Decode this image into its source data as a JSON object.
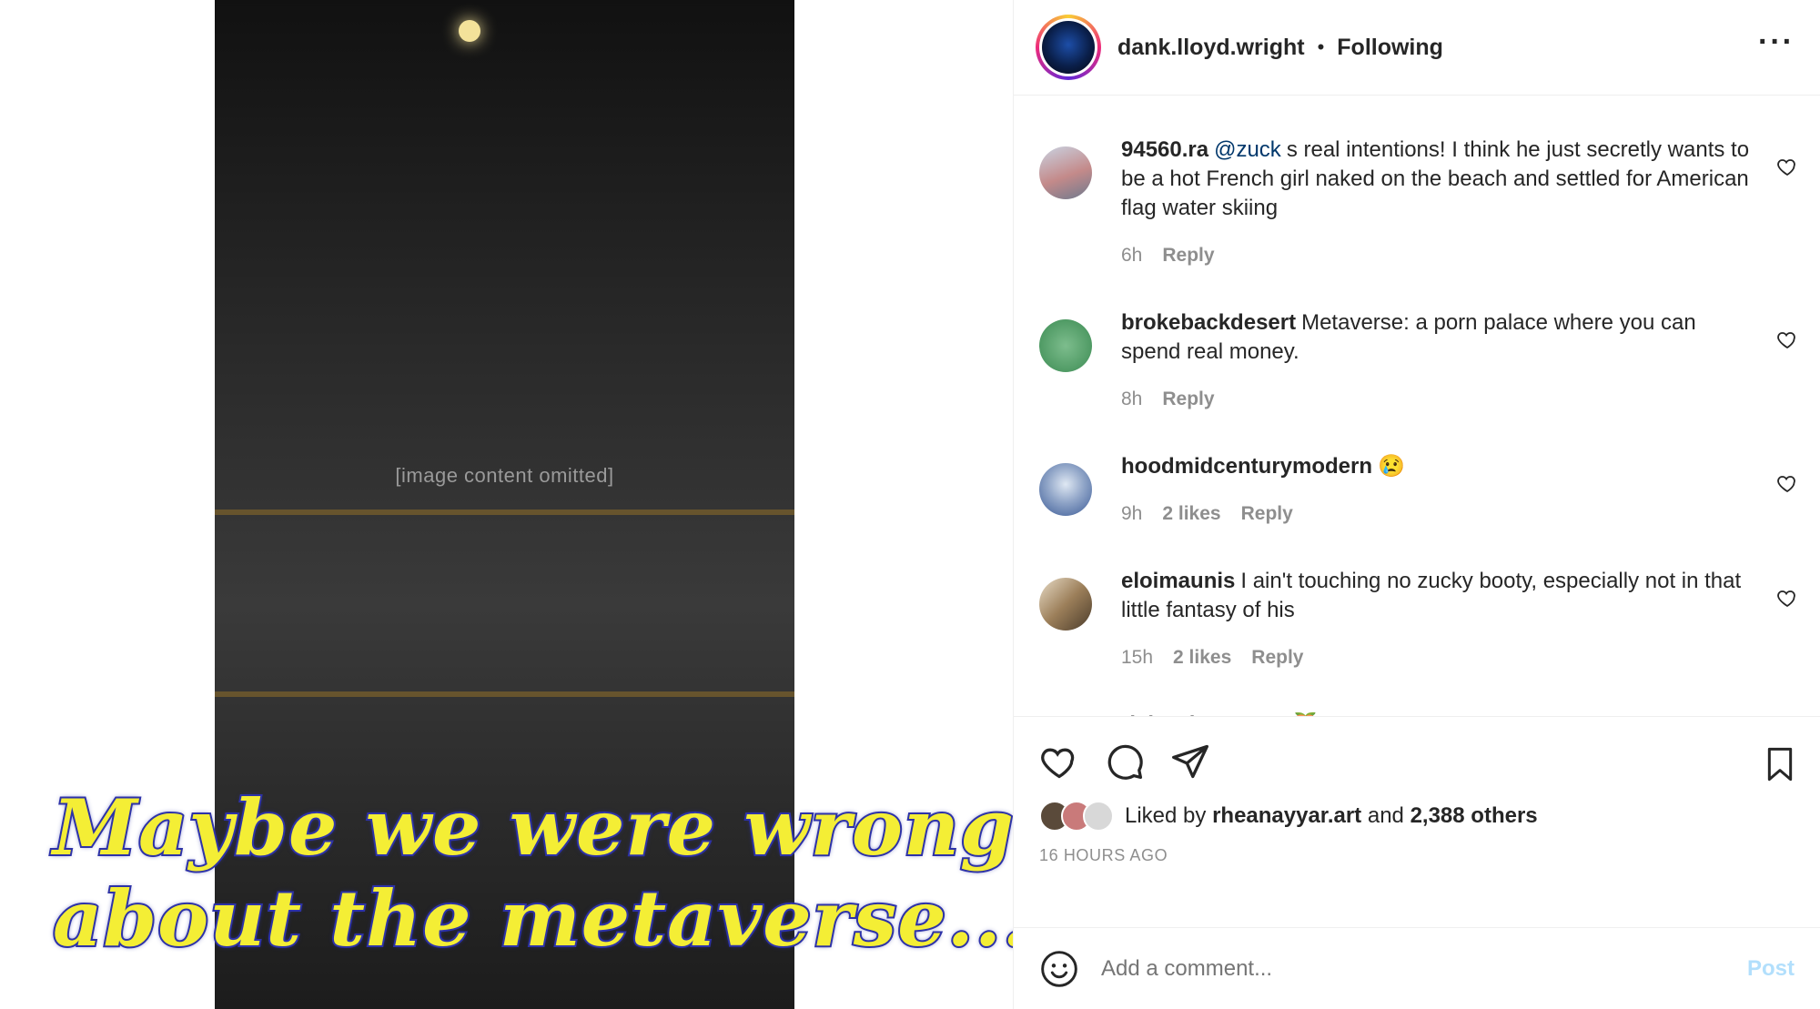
{
  "post": {
    "caption_line1": "Maybe we were wrong",
    "caption_line2": "about the metaverse...",
    "media_note": "[image content omitted]"
  },
  "header": {
    "username": "dank.lloyd.wright",
    "separator": "•",
    "follow_status": "Following",
    "more_icon": "more-horizontal-icon"
  },
  "comments": [
    {
      "username": "94560.ra",
      "mention": "@zuck",
      "text": "s real intentions! I think he just secretly wants to be a hot French girl naked on the beach and settled for American flag water skiing",
      "time": "6h",
      "likes": "",
      "reply": "Reply"
    },
    {
      "username": "brokebackdesert",
      "text": "Metaverse: a porn palace where you can spend real money.",
      "time": "8h",
      "likes": "",
      "reply": "Reply"
    },
    {
      "username": "hoodmidcenturymodern",
      "text": "😢",
      "time": "9h",
      "likes": "2 likes",
      "reply": "Reply"
    },
    {
      "username": "eloimaunis",
      "text": "I ain't touching no zucky booty, especially not in that little fantasy of his",
      "time": "15h",
      "likes": "2 likes",
      "reply": "Reply"
    },
    {
      "username": "richard_ruwater",
      "text": "🍑"
    }
  ],
  "actions": {
    "liked_by_prefix": "Liked by",
    "liked_by_user": "rheanayyar.art",
    "and": "and",
    "others": "2,388 others",
    "time_ago": "16 HOURS AGO"
  },
  "comment_box": {
    "placeholder": "Add a comment...",
    "post_label": "Post"
  },
  "colors": {
    "caption_fill": "#f4ee35",
    "caption_stroke": "#2e33a8",
    "mention": "#00376b",
    "post_disabled": "#b2dffc"
  }
}
